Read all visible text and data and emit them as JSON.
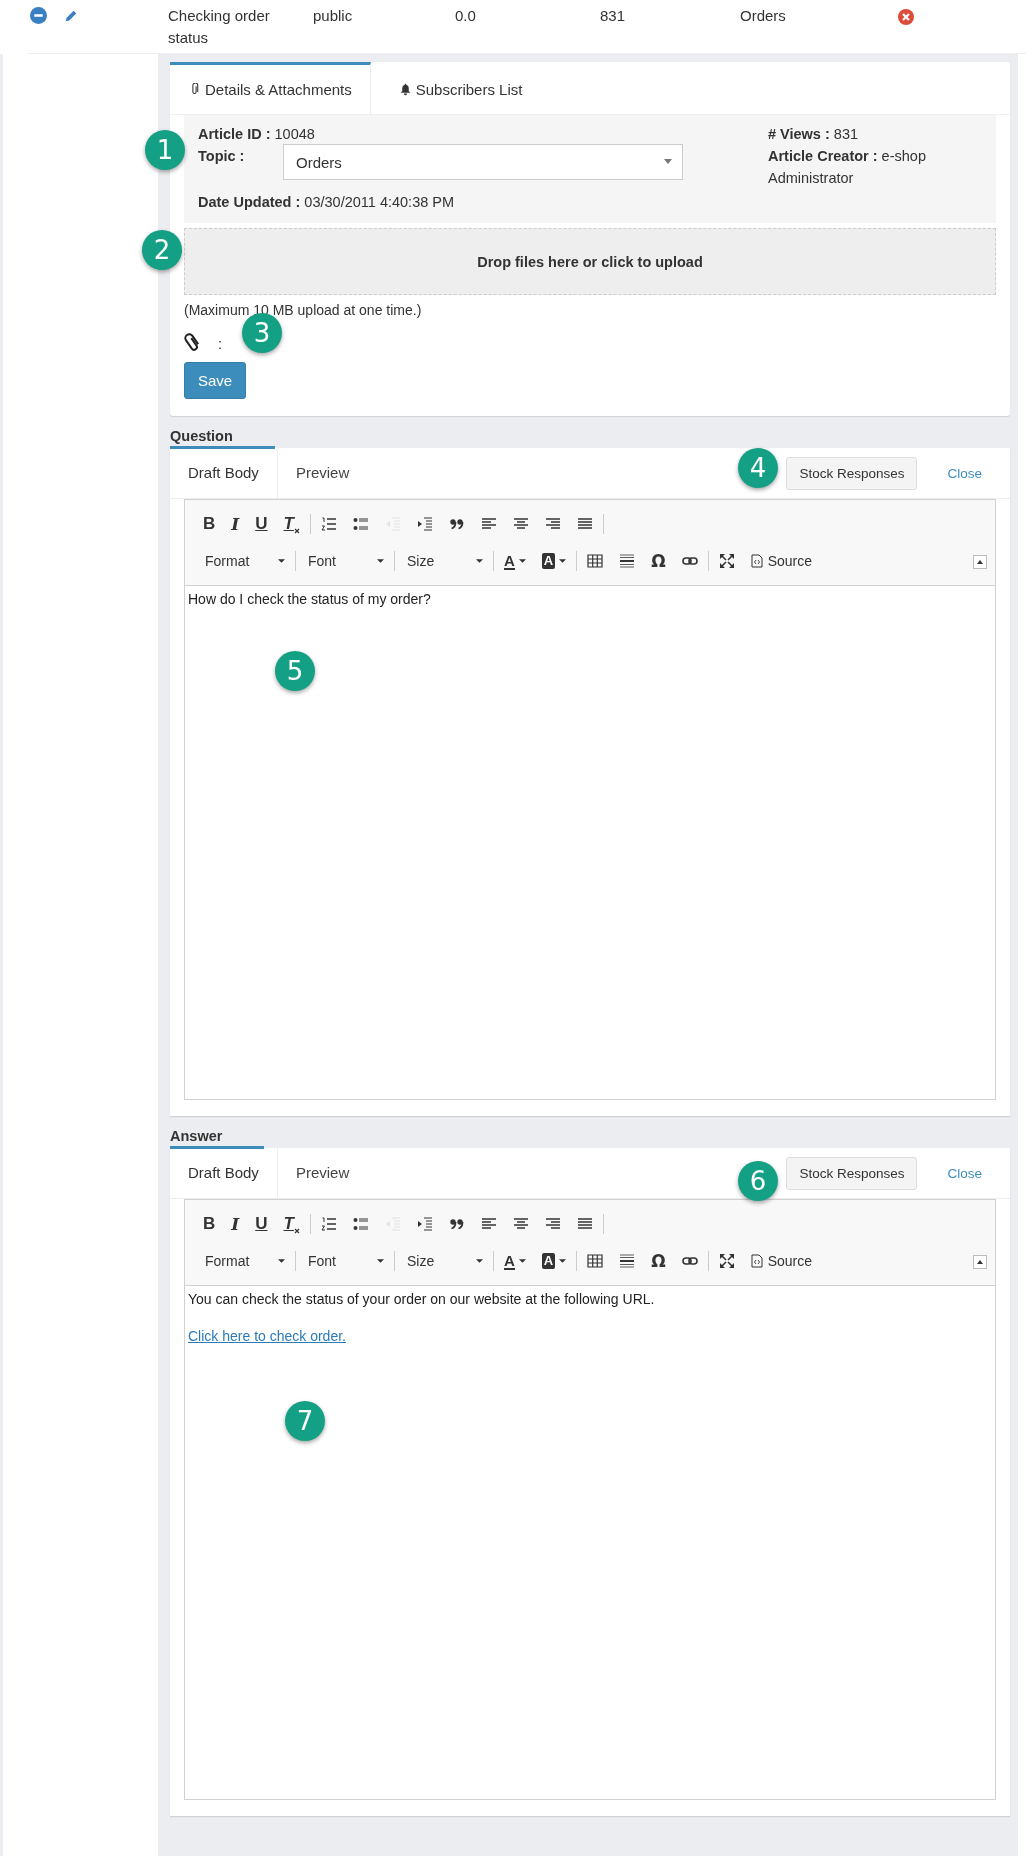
{
  "row": {
    "cells": [
      "Checking order status",
      "public",
      "0.0",
      "831",
      "Orders"
    ]
  },
  "details": {
    "tabs": [
      {
        "label": "Details & Attachments",
        "selected": true
      },
      {
        "label": "Subscribers List",
        "selected": false
      }
    ],
    "article_id": {
      "label": "Article ID :",
      "value": "10048"
    },
    "topic": {
      "label": "Topic :",
      "value": "Orders"
    },
    "date_updated": {
      "label": "Date Updated :",
      "value": "03/30/2011 4:40:38 PM"
    },
    "views": {
      "label": "# Views :",
      "value": "831"
    },
    "creator": {
      "label": "Article Creator :",
      "value": "e-shop Administrator"
    },
    "dropzone": "Drop files here or click to upload",
    "note": "(Maximum 10 MB upload at one time.)",
    "attachments": ":",
    "save": "Save"
  },
  "editors": [
    {
      "label": "Question",
      "tabs": [
        {
          "label": "Draft Body",
          "selected": true
        },
        {
          "label": "Preview",
          "selected": false
        }
      ],
      "stock": "Stock Responses",
      "close": "Close",
      "toolbar": [
        [
          {
            "kind": "bold",
            "text": "B",
            "disabled": false
          },
          {
            "kind": "italic",
            "text": "I",
            "disabled": false
          },
          {
            "kind": "underline",
            "text": "U",
            "disabled": false
          },
          {
            "kind": "clear",
            "text": "T",
            "disabled": false
          },
          {
            "kind": "sep"
          },
          {
            "kind": "numlist",
            "disabled": false
          },
          {
            "kind": "bullist",
            "disabled": false
          },
          {
            "kind": "outdent",
            "disabled": true
          },
          {
            "kind": "indent",
            "disabled": false
          },
          {
            "kind": "quote",
            "disabled": false
          },
          {
            "kind": "align-left",
            "disabled": false
          },
          {
            "kind": "align-center",
            "disabled": false
          },
          {
            "kind": "align-right",
            "disabled": false
          },
          {
            "kind": "justify",
            "disabled": false
          },
          {
            "kind": "sep"
          }
        ],
        [
          {
            "kind": "dropdown",
            "text": "Format",
            "disabled": false
          },
          {
            "kind": "sep"
          },
          {
            "kind": "dropdown",
            "text": "Font",
            "disabled": false
          },
          {
            "kind": "sep"
          },
          {
            "kind": "dropdown",
            "text": "Size",
            "disabled": false
          },
          {
            "kind": "sep"
          },
          {
            "kind": "text-color",
            "text": "A",
            "disabled": false
          },
          {
            "kind": "bg-color",
            "text": "A",
            "disabled": false
          },
          {
            "kind": "sep"
          },
          {
            "kind": "table",
            "disabled": false
          },
          {
            "kind": "rule",
            "disabled": false
          },
          {
            "kind": "omega",
            "text": "Ω",
            "disabled": false
          },
          {
            "kind": "link",
            "disabled": false
          },
          {
            "kind": "sep"
          },
          {
            "kind": "maximize",
            "disabled": false
          },
          {
            "kind": "source",
            "text": "Source",
            "disabled": false
          }
        ]
      ],
      "content": [
        {
          "kind": "text",
          "text": "How do I check the status of my order?"
        }
      ]
    },
    {
      "label": "Answer",
      "tabs": [
        {
          "label": "Draft Body",
          "selected": true
        },
        {
          "label": "Preview",
          "selected": false
        }
      ],
      "stock": "Stock Responses",
      "close": "Close",
      "toolbar": [
        [
          {
            "kind": "bold",
            "text": "B",
            "disabled": false
          },
          {
            "kind": "italic",
            "text": "I",
            "disabled": false
          },
          {
            "kind": "underline",
            "text": "U",
            "disabled": false
          },
          {
            "kind": "clear",
            "text": "T",
            "disabled": false
          },
          {
            "kind": "sep"
          },
          {
            "kind": "numlist",
            "disabled": false
          },
          {
            "kind": "bullist",
            "disabled": false
          },
          {
            "kind": "outdent",
            "disabled": true
          },
          {
            "kind": "indent",
            "disabled": false
          },
          {
            "kind": "quote",
            "disabled": false
          },
          {
            "kind": "align-left",
            "disabled": false
          },
          {
            "kind": "align-center",
            "disabled": false
          },
          {
            "kind": "align-right",
            "disabled": false
          },
          {
            "kind": "justify",
            "disabled": false
          },
          {
            "kind": "sep"
          }
        ],
        [
          {
            "kind": "dropdown",
            "text": "Format",
            "disabled": false
          },
          {
            "kind": "sep"
          },
          {
            "kind": "dropdown",
            "text": "Font",
            "disabled": false
          },
          {
            "kind": "sep"
          },
          {
            "kind": "dropdown",
            "text": "Size",
            "disabled": false
          },
          {
            "kind": "sep"
          },
          {
            "kind": "text-color",
            "text": "A",
            "disabled": false
          },
          {
            "kind": "bg-color",
            "text": "A",
            "disabled": false
          },
          {
            "kind": "sep"
          },
          {
            "kind": "table",
            "disabled": false
          },
          {
            "kind": "rule",
            "disabled": false
          },
          {
            "kind": "omega",
            "text": "Ω",
            "disabled": false
          },
          {
            "kind": "link",
            "disabled": false
          },
          {
            "kind": "sep"
          },
          {
            "kind": "maximize",
            "disabled": false
          },
          {
            "kind": "source",
            "text": "Source",
            "disabled": false
          }
        ]
      ],
      "content": [
        {
          "kind": "text",
          "text": "You can check the status of your order on our website at the following URL."
        },
        {
          "kind": "link",
          "text": "Click here to check order."
        }
      ]
    }
  ],
  "callouts": [
    "1",
    "2",
    "3",
    "4",
    "5",
    "6",
    "7"
  ]
}
